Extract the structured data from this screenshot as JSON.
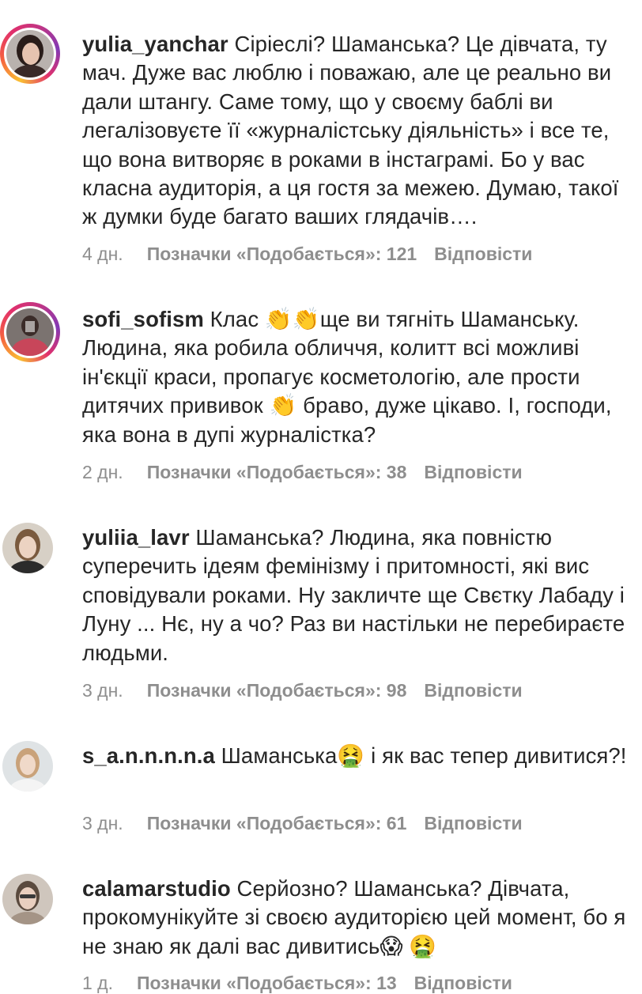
{
  "comments": [
    {
      "username": "yulia_yanchar",
      "text": "Сіріеслі? Шаманська? Це дівчата, ту мач. Дуже вас люблю і поважаю, але це реально ви дали штангу. Саме тому, що у своєму баблі ви легалізовуєте її «журналістську діяльність» і все те, що вона витворяє в роками в інстаграмі. Бо у вас класна аудиторія, а ця гостя за межею. Думаю, такої ж думки буде багато ваших глядачів….",
      "time": "4 дн.",
      "likes": "Позначки «Подобається»: 121",
      "reply": "Відповісти"
    },
    {
      "username": "sofi_sofism",
      "text_parts": [
        "Клас ",
        "👏👏",
        "ще ви тягніть Шаманську. Людина, яка робила обличчя, колитт всі можливі ін'єкції краси, пропагує косметологію, але прости дитячих прививок ",
        "👏",
        " браво, дуже цікаво. І, господи, яка вона в дупі журналістка?"
      ],
      "time": "2 дн.",
      "likes": "Позначки «Подобається»: 38",
      "reply": "Відповісти"
    },
    {
      "username": "yuliia_lavr",
      "text": "Шаманська? Людина, яка повністю суперечить ідеям фемінізму і притомності, які вис сповідували роками. Ну закличте ще Свєтку Лабаду і Луну ... Нє, ну а чо? Раз ви настільки не перебираєте людьми.",
      "time": "3 дн.",
      "likes": "Позначки «Подобається»: 98",
      "reply": "Відповісти"
    },
    {
      "username": "s_a.n.n.n.n.a",
      "text_parts": [
        "Шаманська",
        "🤮",
        " і як вас тепер дивитися?!"
      ],
      "time": "3 дн.",
      "likes": "Позначки «Подобається»: 61",
      "reply": "Відповісти"
    },
    {
      "username": "calamarstudio",
      "text_parts": [
        "Серйозно? Шаманська? Дівчата, прокомунікуйте зі своєю аудиторією цей момент, бо я не знаю як далі вас дивитись",
        "😱",
        " ",
        "🤮"
      ],
      "time": "1 д.",
      "likes": "Позначки «Подобається»: 13",
      "reply": "Відповісти"
    }
  ],
  "colors": {
    "text": "#262626",
    "secondary": "#8e8e8e",
    "story_ring_start": "#f9c033",
    "story_ring_end": "#c13584"
  }
}
